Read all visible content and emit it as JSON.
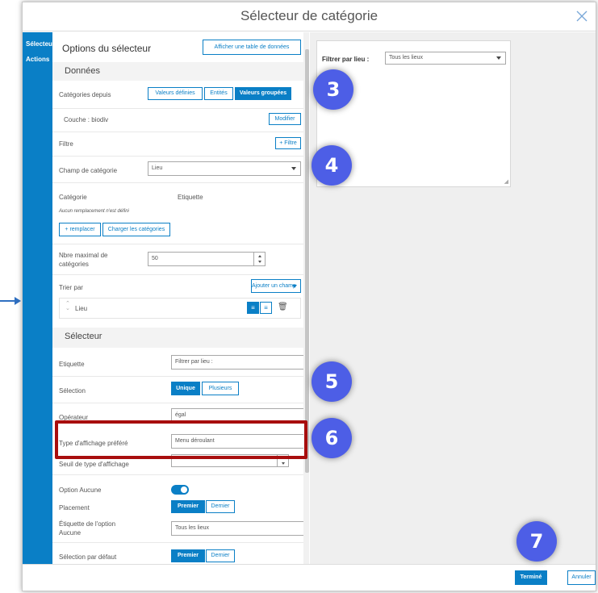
{
  "dialog": {
    "title": "Sélecteur de catégorie"
  },
  "sidebar": {
    "items": [
      {
        "label": "Sélecteur"
      },
      {
        "label": "Actions"
      }
    ]
  },
  "panel": {
    "heading": "Options du sélecteur",
    "show_table_button": "Afficher une table de données",
    "data_section": "Données",
    "categories_from_label": "Catégories depuis",
    "categories_from_options": [
      "Valeurs définies",
      "Entités",
      "Valeurs groupées"
    ],
    "categories_from_selected": "Valeurs groupées",
    "layer_label": "Couche : biodiv",
    "modify_button": "Modifier",
    "filter_label": "Filtre",
    "add_filter_button": "+ Filtre",
    "category_field_label": "Champ de catégorie",
    "category_field_value": "Lieu",
    "category_col": "Catégorie",
    "label_col": "Etiquette",
    "no_override": "Aucun remplacement n'est défini",
    "override_button": "+ remplacer",
    "load_categories_button": "Charger les catégories",
    "max_categories_label": "Nbre maximal de catégories",
    "max_categories_value": "50",
    "sort_by_label": "Trier par",
    "add_field_button": "Ajouter un champ",
    "sort_field": "Lieu",
    "selector_section": "Sélecteur",
    "label_label": "Etiquette",
    "label_value": "Filtrer par lieu :",
    "selection_label": "Sélection",
    "selection_options": [
      "Unique",
      "Plusieurs"
    ],
    "selection_selected": "Unique",
    "operator_label": "Opérateur",
    "operator_value": "égal",
    "display_type_label": "Type d'affichage préféré",
    "display_type_value": "Menu déroulant",
    "display_threshold_label": "Seuil de type d'affichage",
    "none_option_label": "Option Aucune",
    "placement_label": "Placement",
    "placement_options": [
      "Premier",
      "Dernier"
    ],
    "placement_selected": "Premier",
    "none_label_label": "Étiquette de l'option Aucune",
    "none_label_value": "Tous les lieux",
    "default_selection_label": "Sélection par défaut",
    "default_selection_options": [
      "Premier",
      "Dernier"
    ],
    "default_selection_selected": "Premier"
  },
  "preview": {
    "filter_label": "Filtrer par lieu :",
    "dropdown_value": "Tous les lieux"
  },
  "footer": {
    "done_button": "Terminé",
    "cancel_button": "Annuler"
  },
  "badges": [
    "3",
    "4",
    "5",
    "6",
    "7"
  ],
  "colors": {
    "accent": "#0a7fc6",
    "badge": "#4d5ee6",
    "highlight": "#a80e0e"
  }
}
